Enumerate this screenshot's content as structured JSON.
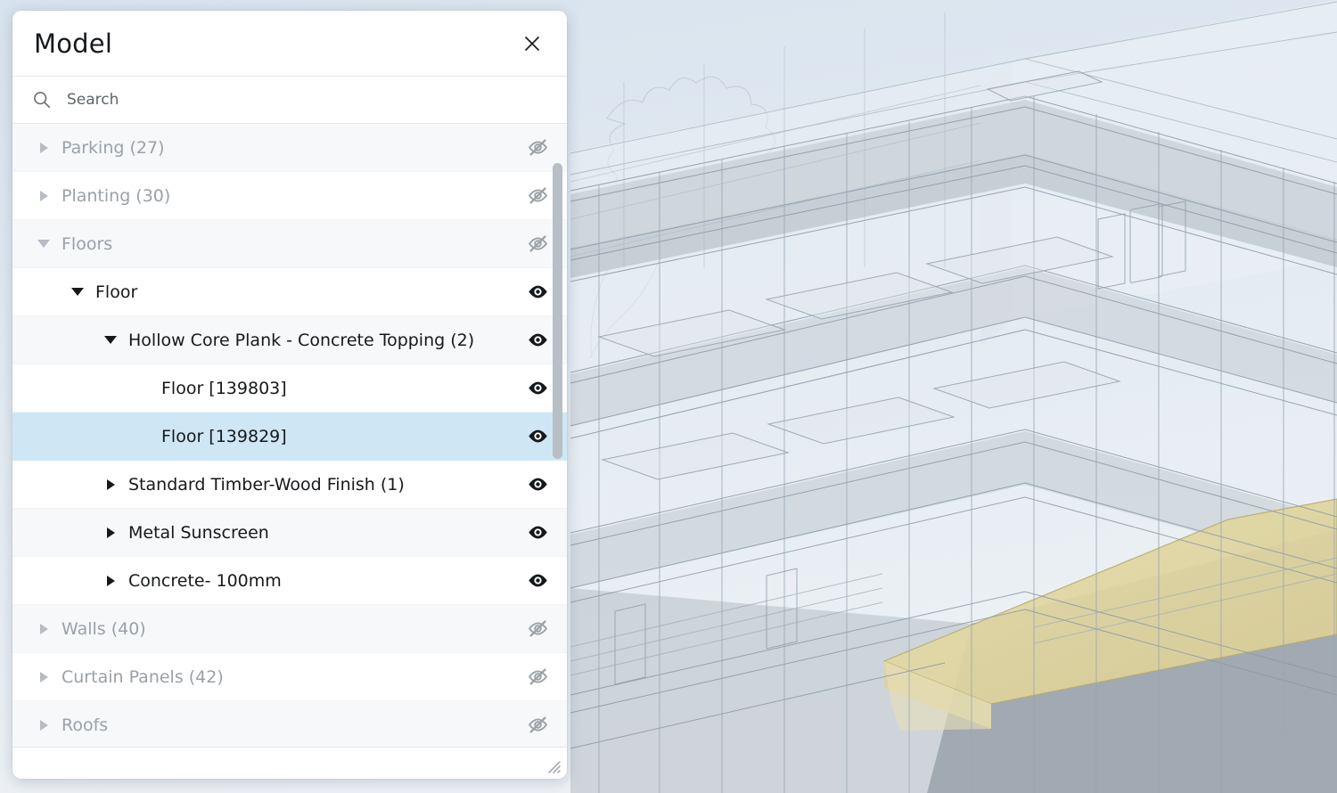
{
  "panel": {
    "title": "Model",
    "close_icon": "close-icon",
    "resize_grip_icon": "resize-grip-icon"
  },
  "search": {
    "icon": "search-icon",
    "placeholder": "Search",
    "value": ""
  },
  "tree": {
    "rows": [
      {
        "label": "Parking (27)",
        "depth": 0,
        "twisty": "collapsed",
        "visible": false,
        "muted": true,
        "selected": false,
        "shade": "alt"
      },
      {
        "label": "Planting (30)",
        "depth": 0,
        "twisty": "collapsed",
        "visible": false,
        "muted": true,
        "selected": false,
        "shade": "plain"
      },
      {
        "label": "Floors",
        "depth": 0,
        "twisty": "expanded",
        "visible": false,
        "muted": true,
        "selected": false,
        "shade": "alt"
      },
      {
        "label": "Floor",
        "depth": 1,
        "twisty": "expanded",
        "visible": true,
        "muted": false,
        "selected": false,
        "shade": "plain"
      },
      {
        "label": "Hollow Core Plank - Concrete Topping (2)",
        "depth": 2,
        "twisty": "expanded",
        "visible": true,
        "muted": false,
        "selected": false,
        "shade": "alt"
      },
      {
        "label": "Floor [139803]",
        "depth": 3,
        "twisty": "none",
        "visible": true,
        "muted": false,
        "selected": false,
        "shade": "plain"
      },
      {
        "label": "Floor [139829]",
        "depth": 3,
        "twisty": "none",
        "visible": true,
        "muted": false,
        "selected": true,
        "shade": "plain"
      },
      {
        "label": "Standard Timber-Wood Finish (1)",
        "depth": 2,
        "twisty": "collapsed",
        "visible": true,
        "muted": false,
        "selected": false,
        "shade": "plain"
      },
      {
        "label": "Metal Sunscreen",
        "depth": 2,
        "twisty": "collapsed",
        "visible": true,
        "muted": false,
        "selected": false,
        "shade": "alt"
      },
      {
        "label": "Concrete- 100mm",
        "depth": 2,
        "twisty": "collapsed",
        "visible": true,
        "muted": false,
        "selected": false,
        "shade": "plain"
      },
      {
        "label": "Walls (40)",
        "depth": 0,
        "twisty": "collapsed",
        "visible": false,
        "muted": true,
        "selected": false,
        "shade": "alt"
      },
      {
        "label": "Curtain Panels (42)",
        "depth": 0,
        "twisty": "collapsed",
        "visible": false,
        "muted": true,
        "selected": false,
        "shade": "plain"
      },
      {
        "label": "Roofs",
        "depth": 0,
        "twisty": "collapsed",
        "visible": false,
        "muted": true,
        "selected": false,
        "shade": "alt"
      }
    ],
    "visible_icon": "eye-icon",
    "hidden_icon": "eye-off-icon",
    "scrollbar": {
      "name": "tree-scrollbar"
    }
  },
  "viewport": {
    "name": "3d-model-viewport",
    "selection_highlight_color": "#ddd19a",
    "sky_color": "#dee8f0",
    "model_line_color": "#8b98a6"
  }
}
